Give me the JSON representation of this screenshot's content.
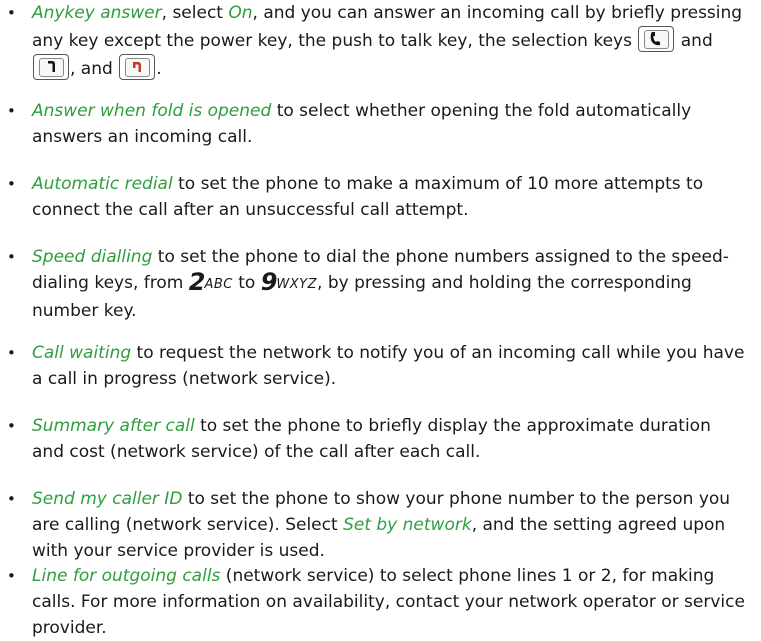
{
  "colors": {
    "term": "#2e9e3e",
    "text": "#1a1a1a",
    "end_key": "#c0392b"
  },
  "icons": {
    "call_key": "call-key-icon",
    "right_selection_key": "right-selection-key-icon",
    "end_key": "end-key-icon"
  },
  "items": [
    {
      "term": "Anykey answer",
      "text_a": ", select ",
      "option": "On",
      "text_b": ", and you can answer an incoming call by briefly pressing any key except the power key, the push to talk key, the selection keys ",
      "text_c": " and ",
      "text_d": ", and ",
      "text_e": "."
    },
    {
      "term": "Answer when fold is opened",
      "text": " to select whether opening the fold automatically answers an incoming call."
    },
    {
      "term": "Automatic redial",
      "text": " to set the phone to make a maximum of 10 more attempts to connect the call after an unsuccessful call attempt."
    },
    {
      "term": "Speed dialling",
      "text_a": " to set the phone to dial the phone numbers assigned to the speed-dialing keys, from ",
      "key_from_digit": "2",
      "key_from_letters": "ABC",
      "text_b": " to ",
      "key_to_digit": "9",
      "key_to_letters": "WXYZ",
      "text_c": ", by pressing and holding the corresponding number key."
    },
    {
      "term": "Call waiting",
      "text": " to request the network to notify you of an incoming call while you have a call in progress (network service)."
    },
    {
      "term": "Summary after call",
      "text": " to set the phone to briefly display the approximate duration and cost (network service) of the call after each call."
    },
    {
      "term": "Send my caller ID",
      "text_a": " to set the phone to show your phone number to the person you are calling (network service). Select ",
      "option": "Set by network",
      "text_b": ", and the setting agreed upon with your service provider is used."
    },
    {
      "term": "Line for outgoing calls",
      "text": " (network service) to select phone lines 1 or 2, for making calls. For more information on availability, contact your network operator or service provider."
    }
  ]
}
